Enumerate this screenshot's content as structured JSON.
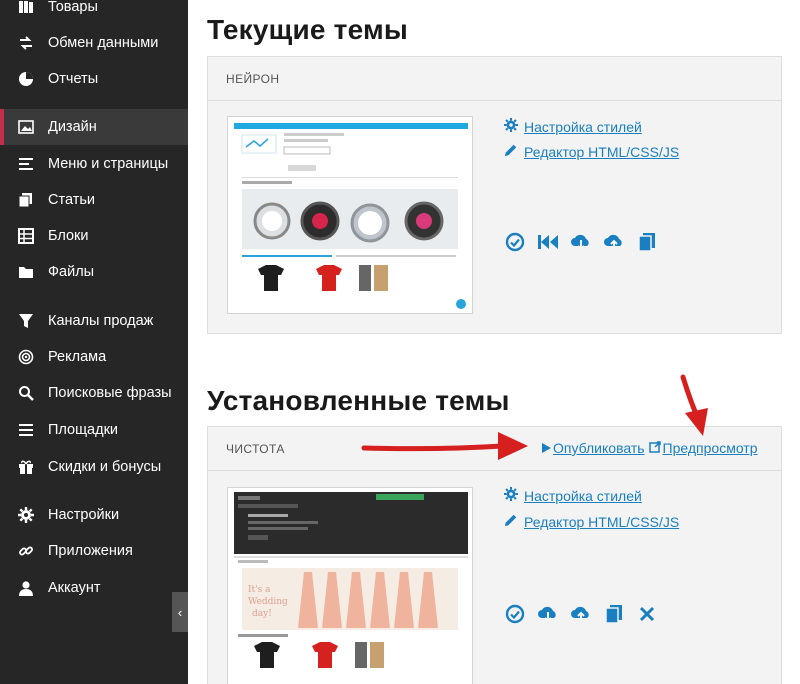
{
  "sidebar": {
    "items": [
      {
        "label": "Товары",
        "icon": "book-icon"
      },
      {
        "label": "Обмен данными",
        "icon": "exchange-icon"
      },
      {
        "label": "Отчеты",
        "icon": "pie-chart-icon"
      },
      {
        "label": "Дизайн",
        "icon": "image-icon"
      },
      {
        "label": "Меню и страницы",
        "icon": "list-icon"
      },
      {
        "label": "Статьи",
        "icon": "files-icon"
      },
      {
        "label": "Блоки",
        "icon": "table-icon"
      },
      {
        "label": "Файлы",
        "icon": "folder-icon"
      },
      {
        "label": "Каналы продаж",
        "icon": "filter-icon"
      },
      {
        "label": "Реклама",
        "icon": "target-icon"
      },
      {
        "label": "Поисковые фразы",
        "icon": "search-icon"
      },
      {
        "label": "Площадки",
        "icon": "lines-icon"
      },
      {
        "label": "Скидки и бонусы",
        "icon": "gift-icon"
      },
      {
        "label": "Настройки",
        "icon": "gear-icon"
      },
      {
        "label": "Приложения",
        "icon": "link-icon"
      },
      {
        "label": "Аккаунт",
        "icon": "user-icon"
      }
    ],
    "active_label": "Дизайн",
    "collapse_glyph": "‹"
  },
  "current": {
    "title": "Текущие темы",
    "theme_name": "НЕЙРОН",
    "style_link": "Настройка стилей",
    "editor_link": "Редактор HTML/CSS/JS"
  },
  "installed": {
    "title": "Установленные темы",
    "theme_name": "ЧИСТОТА",
    "publish": "Опубликовать",
    "preview": "Предпросмотр",
    "style_link": "Настройка стилей",
    "editor_link": "Редактор HTML/CSS/JS"
  },
  "colors": {
    "accent": "#1a7fc1",
    "sidebar_bg": "#262626",
    "active_marker": "#c42e4a",
    "arrow": "#d61f1f"
  }
}
